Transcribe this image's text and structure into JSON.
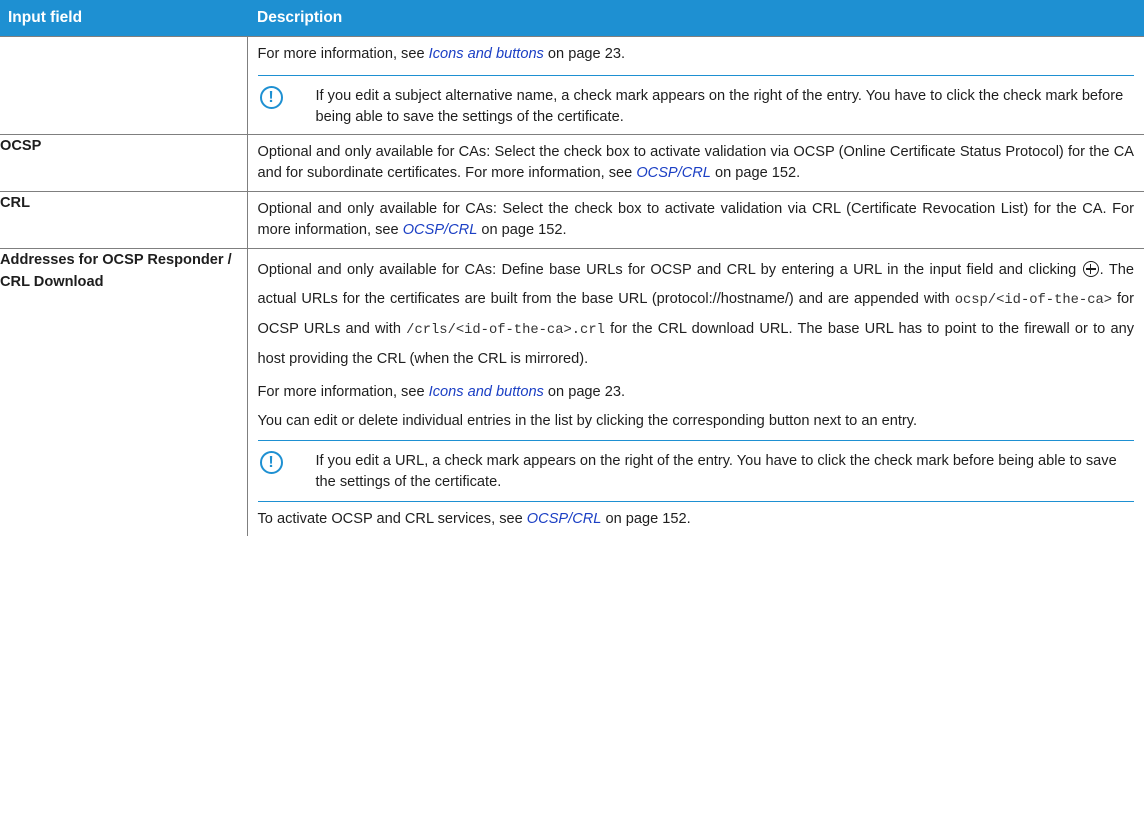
{
  "header": {
    "col1": "Input field",
    "col2": "Description"
  },
  "row_continued": {
    "para1": {
      "pre": "For more information, see ",
      "link": "Icons and buttons",
      "post": " on page 23."
    },
    "note": "If you edit a subject alternative name, a check mark appears on the right of the entry. You have to click the check mark before being able to save the settings of the certificate."
  },
  "row_ocsp": {
    "label": "OCSP",
    "pre": "Optional and only available for CAs: Select the check box to activate validation via OCSP (Online Certificate Status Protocol) for the CA and for subordinate certificates. For more information, see ",
    "link": "OCSP/CRL",
    "post": " on page 152."
  },
  "row_crl": {
    "label": "CRL",
    "pre": "Optional and only available for CAs: Select the check box to activate validation via CRL (Certificate Revocation List) for the CA. For more information, see ",
    "link": "OCSP/CRL",
    "post": " on page 152."
  },
  "row_addresses": {
    "label": "Addresses for OCSP Responder / CRL Download",
    "p1": {
      "t1": "Optional and only available for CAs: Define base URLs for OCSP and CRL by entering a URL in the input field and clicking ",
      "t2": ". The actual URLs for the certificates are built from the base URL (protocol://hostname/) and are appended with ",
      "code1": "ocsp/<id-of-the-ca>",
      "t3": " for OCSP URLs and with ",
      "code2": "/crls/<id-of-the-ca>.crl",
      "t4": " for the CRL download URL. The base URL has to point to the firewall or to any host providing the CRL (when the CRL is mirrored)."
    },
    "p2": {
      "pre": "For more information, see ",
      "link": "Icons and buttons",
      "post": " on page 23."
    },
    "p3": "You can edit or delete individual entries in the list by clicking the corresponding button next to an entry.",
    "note": "If you edit a URL, a check mark appears on the right of the entry. You have to click the check mark before being able to save the settings of the certificate.",
    "p4": {
      "pre": "To activate OCSP and CRL services, see ",
      "link": "OCSP/CRL",
      "post": " on page 152."
    }
  },
  "icons": {
    "note": "exclamation-circle-icon",
    "add": "circled-plus-icon"
  },
  "colors": {
    "header_bg": "#1e90d2",
    "link": "#1b3fc4",
    "note_rule": "#1e90d2"
  }
}
